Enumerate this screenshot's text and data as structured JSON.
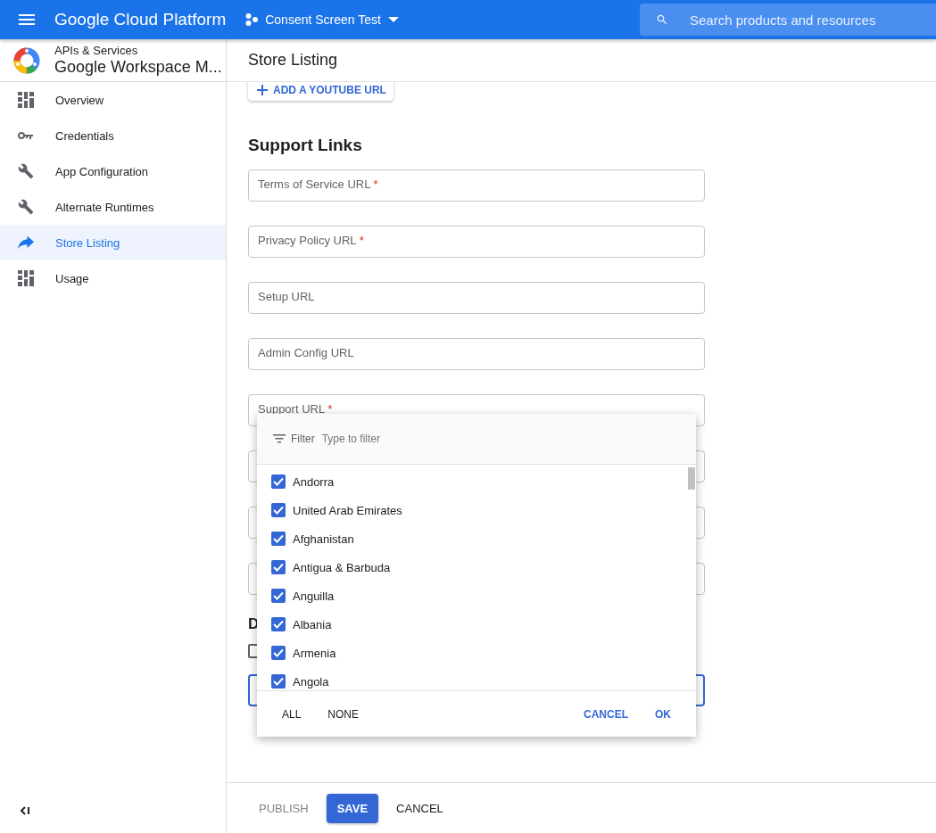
{
  "topbar": {
    "brand": "Google Cloud Platform",
    "project": "Consent Screen Test",
    "search": {
      "placeholder": "Search products and resources"
    }
  },
  "sidebar": {
    "section": "APIs & Services",
    "app_name": "Google Workspace M...",
    "items": [
      {
        "label": "Overview",
        "kind": "grid",
        "selected": false
      },
      {
        "label": "Credentials",
        "kind": "key",
        "selected": false
      },
      {
        "label": "App Configuration",
        "kind": "wrench",
        "selected": false
      },
      {
        "label": "Alternate Runtimes",
        "kind": "wrench",
        "selected": false
      },
      {
        "label": "Store Listing",
        "kind": "share",
        "selected": true
      },
      {
        "label": "Usage",
        "kind": "grid",
        "selected": false
      }
    ]
  },
  "page_title": "Store Listing",
  "add_youtube_button": "ADD A YOUTUBE URL",
  "support_links": {
    "heading": "Support Links",
    "fields": [
      {
        "kind": "field",
        "label": "Terms of Service URL",
        "required_mark": "*"
      },
      {
        "kind": "field",
        "label": "Privacy Policy URL",
        "required_mark": "*"
      },
      {
        "kind": "field",
        "label": "Setup URL"
      },
      {
        "kind": "field",
        "label": "Admin Config URL"
      },
      {
        "kind": "field",
        "label": "Support URL",
        "required_mark": "*"
      },
      {
        "kind": "field"
      },
      {
        "kind": "field"
      },
      {
        "kind": "field"
      }
    ]
  },
  "partial_section": {
    "heading": "D",
    "checkbox": {
      "checked": false
    },
    "field": {
      "focused": true
    }
  },
  "region_dropdown": {
    "filter_label": "Filter",
    "filter_placeholder": "Type to filter",
    "options": [
      {
        "label": "Andorra",
        "checked": true
      },
      {
        "label": "United Arab Emirates",
        "checked": true
      },
      {
        "label": "Afghanistan",
        "checked": true
      },
      {
        "label": "Antigua & Barbuda",
        "checked": true
      },
      {
        "label": "Anguilla",
        "checked": true
      },
      {
        "label": "Albania",
        "checked": true
      },
      {
        "label": "Armenia",
        "checked": true
      },
      {
        "label": "Angola",
        "checked": true
      }
    ],
    "left_buttons": [
      "ALL",
      "NONE"
    ],
    "right_buttons": [
      "CANCEL",
      "OK"
    ]
  },
  "footer": {
    "buttons": [
      {
        "label": "PUBLISH",
        "kind": "text",
        "disabled": true
      },
      {
        "label": "SAVE",
        "kind": "primary",
        "disabled": false
      },
      {
        "label": "CANCEL",
        "kind": "text",
        "disabled": false
      }
    ]
  }
}
